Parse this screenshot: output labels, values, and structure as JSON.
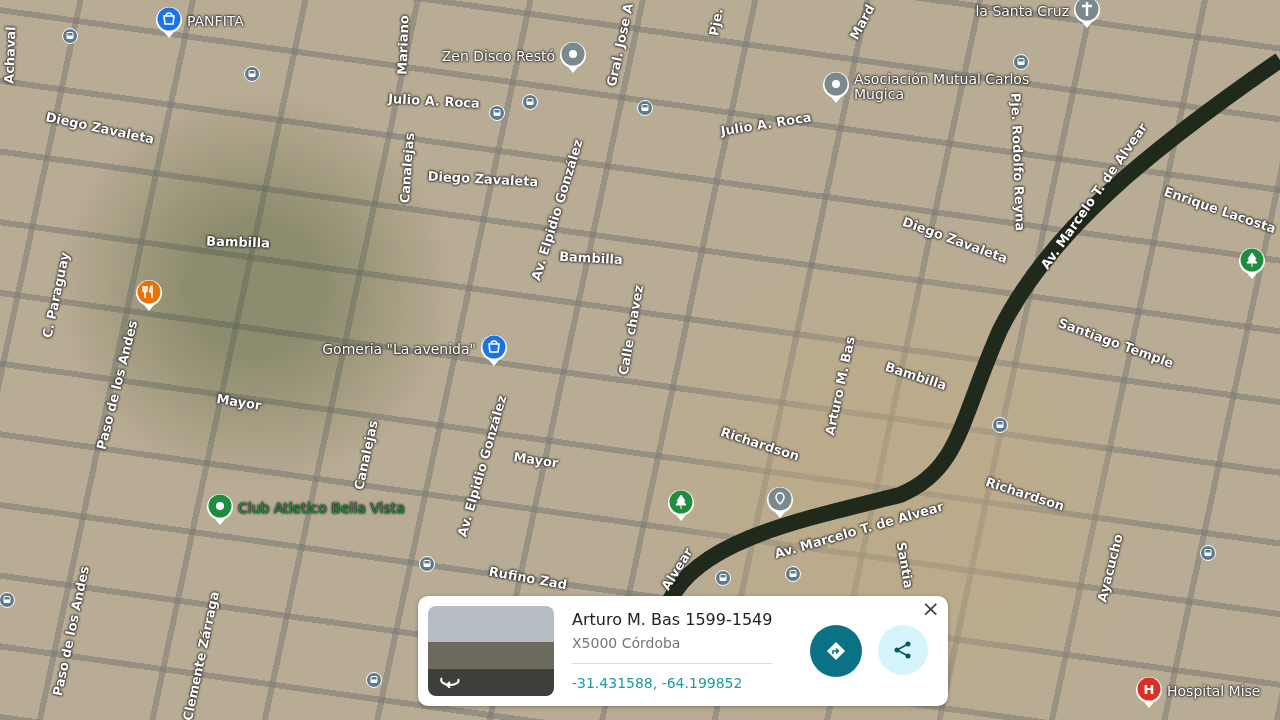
{
  "map": {
    "streets": [
      {
        "name": "Achaval"
      },
      {
        "name": "Mariano"
      },
      {
        "name": "Gral. Jose A"
      },
      {
        "name": "Pje."
      },
      {
        "name": "Mard"
      },
      {
        "name": "Julio A. Roca"
      },
      {
        "name": "Julio A. Roca"
      },
      {
        "name": "Diego Zavaleta"
      },
      {
        "name": "Canalejas"
      },
      {
        "name": "Av. Elpidio González"
      },
      {
        "name": "Diego Zavaleta"
      },
      {
        "name": "Pje. Rodolfo Reyna"
      },
      {
        "name": "Av. Marcelo T. de Alvear"
      },
      {
        "name": "Enrique Lacosta"
      },
      {
        "name": "Bambilla"
      },
      {
        "name": "Bambilla"
      },
      {
        "name": "Diego Zavaleta"
      },
      {
        "name": "C. Paraguay"
      },
      {
        "name": "Paso de los Andes"
      },
      {
        "name": "Calle chavez"
      },
      {
        "name": "Santiago Temple"
      },
      {
        "name": "Bambilla"
      },
      {
        "name": "Arturo M. Bas"
      },
      {
        "name": "Mayor"
      },
      {
        "name": "Canalejas"
      },
      {
        "name": "Av. Elpidio González"
      },
      {
        "name": "Richardson"
      },
      {
        "name": "Mayor"
      },
      {
        "name": "Richardson"
      },
      {
        "name": "Av. Marcelo T. de Alvear"
      },
      {
        "name": "Alvear"
      },
      {
        "name": "Rufino Zad"
      },
      {
        "name": "Santia"
      },
      {
        "name": "Ayacucho"
      },
      {
        "name": "Paso de los Andes"
      },
      {
        "name": "Clemente Zárraga"
      }
    ],
    "places": [
      {
        "name": "PANFITA",
        "kind": "shop",
        "color": "#1a73e8"
      },
      {
        "name": "la Santa Cruz",
        "kind": "church",
        "color": "#7a8a8c"
      },
      {
        "name": "Zen Disco Restó",
        "kind": "place",
        "color": "#7a8a8c"
      },
      {
        "name": "Asociación Mutual Carlos Mugica",
        "kind": "place",
        "color": "#7a8a8c"
      },
      {
        "name": "Gomeria \"La avenida\"",
        "kind": "shop",
        "color": "#1a73e8"
      },
      {
        "kind": "food",
        "color": "#e8710a"
      },
      {
        "kind": "park",
        "color": "#1e8e3e"
      },
      {
        "name": "Club Atletico Bella Vista",
        "kind": "place",
        "color": "#1e8e3e"
      },
      {
        "kind": "park",
        "color": "#1e8e3e"
      },
      {
        "kind": "small",
        "color": "#7a8a8c"
      },
      {
        "name": "Hospital Mise",
        "kind": "hospital",
        "color": "#d93025",
        "glyph": "H"
      }
    ]
  },
  "card": {
    "title": "Arturo M. Bas 1599-1549",
    "subtitle": "X5000 Córdoba",
    "coordinates": "-31.431588, -64.199852",
    "close": "×"
  }
}
